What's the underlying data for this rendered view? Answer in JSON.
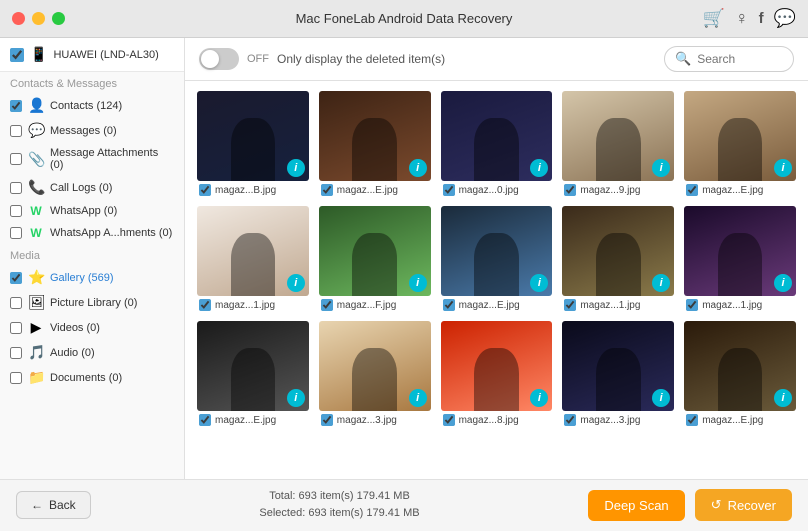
{
  "titlebar": {
    "title": "Mac FoneLab Android Data Recovery",
    "buttons": {
      "close": "●",
      "min": "●",
      "max": "●"
    },
    "icons": [
      "🛒",
      "♀",
      "f",
      "💬"
    ]
  },
  "topbar": {
    "toggle": {
      "state": "OFF",
      "label": "OFF"
    },
    "toggle_text": "Only display the deleted item(s)",
    "search": {
      "placeholder": "Search"
    }
  },
  "sidebar": {
    "device": {
      "name": "HUAWEI (LND-AL30)"
    },
    "sections": [
      {
        "label": "Contacts & Messages",
        "items": [
          {
            "label": "Contacts (124)",
            "checked": true,
            "icon": "👤",
            "color": "orange"
          },
          {
            "label": "Messages (0)",
            "checked": false,
            "icon": "💬",
            "color": "yellow"
          },
          {
            "label": "Message Attachments (0)",
            "checked": false,
            "icon": "📎",
            "color": "green"
          },
          {
            "label": "Call Logs (0)",
            "checked": false,
            "icon": "📞",
            "color": "green"
          },
          {
            "label": "WhatsApp (0)",
            "checked": false,
            "icon": "W",
            "color": "green"
          },
          {
            "label": "WhatsApp A...hments (0)",
            "checked": false,
            "icon": "W",
            "color": "green"
          }
        ]
      },
      {
        "label": "Media",
        "items": [
          {
            "label": "Gallery (569)",
            "checked": true,
            "icon": "⭐",
            "color": "gold",
            "active": true
          },
          {
            "label": "Picture Library (0)",
            "checked": false,
            "icon": "🖼",
            "color": "blue"
          },
          {
            "label": "Videos (0)",
            "checked": false,
            "icon": "▶",
            "color": "purple"
          },
          {
            "label": "Audio (0)",
            "checked": false,
            "icon": "🎵",
            "color": "red"
          },
          {
            "label": "Documents (0)",
            "checked": false,
            "icon": "📁",
            "color": "orange"
          }
        ]
      }
    ]
  },
  "grid": {
    "items": [
      {
        "name": "magaz...B.jpg",
        "photo_class": "photo-1",
        "checked": true
      },
      {
        "name": "magaz...E.jpg",
        "photo_class": "photo-2",
        "checked": true
      },
      {
        "name": "magaz...0.jpg",
        "photo_class": "photo-3",
        "checked": true
      },
      {
        "name": "magaz...9.jpg",
        "photo_class": "photo-4",
        "checked": true
      },
      {
        "name": "magaz...E.jpg",
        "photo_class": "photo-5",
        "checked": true
      },
      {
        "name": "magaz...1.jpg",
        "photo_class": "photo-6",
        "checked": true
      },
      {
        "name": "magaz...F.jpg",
        "photo_class": "photo-7",
        "checked": true
      },
      {
        "name": "magaz...E.jpg",
        "photo_class": "photo-8",
        "checked": true
      },
      {
        "name": "magaz...1.jpg",
        "photo_class": "photo-9",
        "checked": true
      },
      {
        "name": "magaz...1.jpg",
        "photo_class": "photo-10",
        "checked": true
      },
      {
        "name": "magaz...E.jpg",
        "photo_class": "photo-11",
        "checked": true
      },
      {
        "name": "magaz...3.jpg",
        "photo_class": "photo-12",
        "checked": true
      },
      {
        "name": "magaz...8.jpg",
        "photo_class": "photo-13",
        "checked": true
      },
      {
        "name": "magaz...3.jpg",
        "photo_class": "photo-14",
        "checked": true
      },
      {
        "name": "magaz...E.jpg",
        "photo_class": "photo-15",
        "checked": true
      }
    ]
  },
  "footer": {
    "total": "Total: 693 item(s) 179.41 MB",
    "selected": "Selected: 693 item(s) 179.41 MB",
    "back_label": "Back",
    "deep_scan_label": "Deep Scan",
    "recover_label": "Recover"
  }
}
